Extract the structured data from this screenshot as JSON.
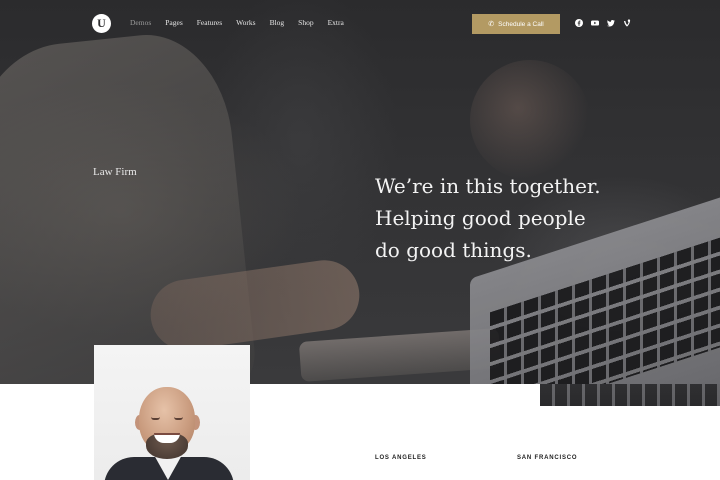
{
  "nav": {
    "logo_text": "U",
    "menu": [
      {
        "label": "Demos",
        "active": true
      },
      {
        "label": "Pages"
      },
      {
        "label": "Features"
      },
      {
        "label": "Works"
      },
      {
        "label": "Blog"
      },
      {
        "label": "Shop"
      },
      {
        "label": "Extra"
      }
    ],
    "cta_label": "Schedule a Call",
    "cta_icon": "phone-icon",
    "social_icons": [
      "facebook-icon",
      "youtube-icon",
      "twitter-icon",
      "vine-icon"
    ]
  },
  "hero": {
    "eyebrow": "Law Firm",
    "headline_lines": [
      "We’re in this together.",
      "Helping good people",
      "do good things."
    ]
  },
  "offices": {
    "cities": [
      "LOS ANGELES",
      "SAN FRANCISCO"
    ]
  },
  "colors": {
    "accent": "#b39a63",
    "hero_dark": "#2b2b2d",
    "text_light": "#f3f3f3"
  }
}
